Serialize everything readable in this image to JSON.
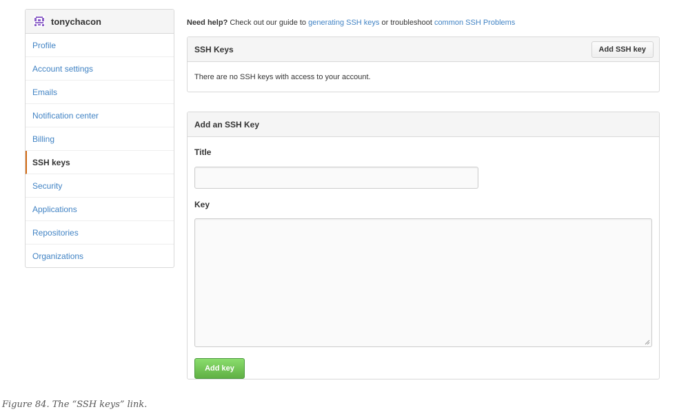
{
  "sidebar": {
    "username": "tonychacon",
    "items": [
      {
        "label": "Profile"
      },
      {
        "label": "Account settings"
      },
      {
        "label": "Emails"
      },
      {
        "label": "Notification center"
      },
      {
        "label": "Billing"
      },
      {
        "label": "SSH keys",
        "selected": true
      },
      {
        "label": "Security"
      },
      {
        "label": "Applications"
      },
      {
        "label": "Repositories"
      },
      {
        "label": "Organizations"
      }
    ]
  },
  "help": {
    "bold": "Need help?",
    "text1": " Check out our guide to ",
    "link1": "generating SSH keys",
    "text2": " or troubleshoot ",
    "link2": "common SSH Problems"
  },
  "ssh_keys_box": {
    "title": "SSH Keys",
    "add_button": "Add SSH key",
    "empty_text": "There are no SSH keys with access to your account."
  },
  "add_key_form": {
    "title": "Add an SSH Key",
    "title_label": "Title",
    "title_value": "",
    "key_label": "Key",
    "key_value": "",
    "submit": "Add key"
  },
  "caption": "Figure 84. The “SSH keys” link.",
  "colors": {
    "link": "#4183c4",
    "selected_accent": "#d26911",
    "submit_green": "#60b044",
    "avatar": "#8b5fc7"
  }
}
